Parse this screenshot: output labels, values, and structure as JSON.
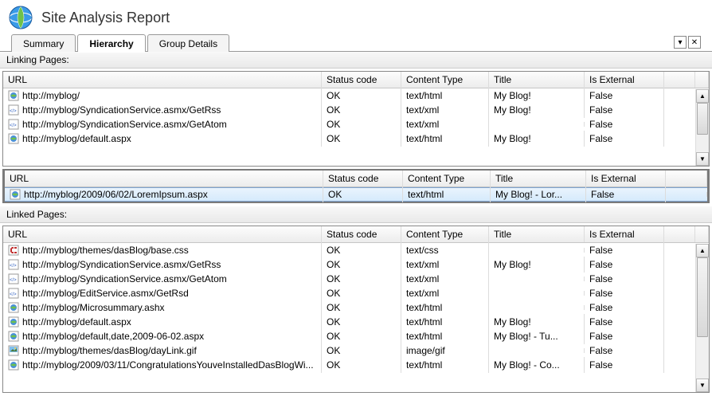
{
  "app": {
    "title": "Site Analysis Report"
  },
  "tabs": {
    "summary": "Summary",
    "hierarchy": "Hierarchy",
    "group_details": "Group Details"
  },
  "sections": {
    "linking": "Linking Pages:",
    "linked": "Linked Pages:"
  },
  "columns": {
    "url": "URL",
    "status": "Status code",
    "ctype": "Content Type",
    "title": "Title",
    "ext": "Is External"
  },
  "linking_rows": [
    {
      "icon": "html",
      "url": "http://myblog/",
      "status": "OK",
      "ctype": "text/html",
      "title": "My Blog!",
      "ext": "False"
    },
    {
      "icon": "xml",
      "url": "http://myblog/SyndicationService.asmx/GetRss",
      "status": "OK",
      "ctype": "text/xml",
      "title": "My Blog!",
      "ext": "False"
    },
    {
      "icon": "xml",
      "url": "http://myblog/SyndicationService.asmx/GetAtom",
      "status": "OK",
      "ctype": "text/xml",
      "title": "",
      "ext": "False"
    },
    {
      "icon": "html",
      "url": "http://myblog/default.aspx",
      "status": "OK",
      "ctype": "text/html",
      "title": "My Blog!",
      "ext": "False"
    }
  ],
  "selected_row": {
    "icon": "html",
    "url": "http://myblog/2009/06/02/LoremIpsum.aspx",
    "status": "OK",
    "ctype": "text/html",
    "title": "My Blog! - Lor...",
    "ext": "False"
  },
  "linked_rows": [
    {
      "icon": "css",
      "url": "http://myblog/themes/dasBlog/base.css",
      "status": "OK",
      "ctype": "text/css",
      "title": "",
      "ext": "False"
    },
    {
      "icon": "xml",
      "url": "http://myblog/SyndicationService.asmx/GetRss",
      "status": "OK",
      "ctype": "text/xml",
      "title": "My Blog!",
      "ext": "False"
    },
    {
      "icon": "xml",
      "url": "http://myblog/SyndicationService.asmx/GetAtom",
      "status": "OK",
      "ctype": "text/xml",
      "title": "",
      "ext": "False"
    },
    {
      "icon": "xml",
      "url": "http://myblog/EditService.asmx/GetRsd",
      "status": "OK",
      "ctype": "text/xml",
      "title": "",
      "ext": "False"
    },
    {
      "icon": "html",
      "url": "http://myblog/Microsummary.ashx",
      "status": "OK",
      "ctype": "text/html",
      "title": "",
      "ext": "False"
    },
    {
      "icon": "html",
      "url": "http://myblog/default.aspx",
      "status": "OK",
      "ctype": "text/html",
      "title": "My Blog!",
      "ext": "False"
    },
    {
      "icon": "html",
      "url": "http://myblog/default,date,2009-06-02.aspx",
      "status": "OK",
      "ctype": "text/html",
      "title": "My Blog! - Tu...",
      "ext": "False"
    },
    {
      "icon": "gif",
      "url": "http://myblog/themes/dasBlog/dayLink.gif",
      "status": "OK",
      "ctype": "image/gif",
      "title": "",
      "ext": "False"
    },
    {
      "icon": "html",
      "url": "http://myblog/2009/03/11/CongratulationsYouveInstalledDasBlogWi...",
      "status": "OK",
      "ctype": "text/html",
      "title": "My Blog! - Co...",
      "ext": "False"
    }
  ]
}
